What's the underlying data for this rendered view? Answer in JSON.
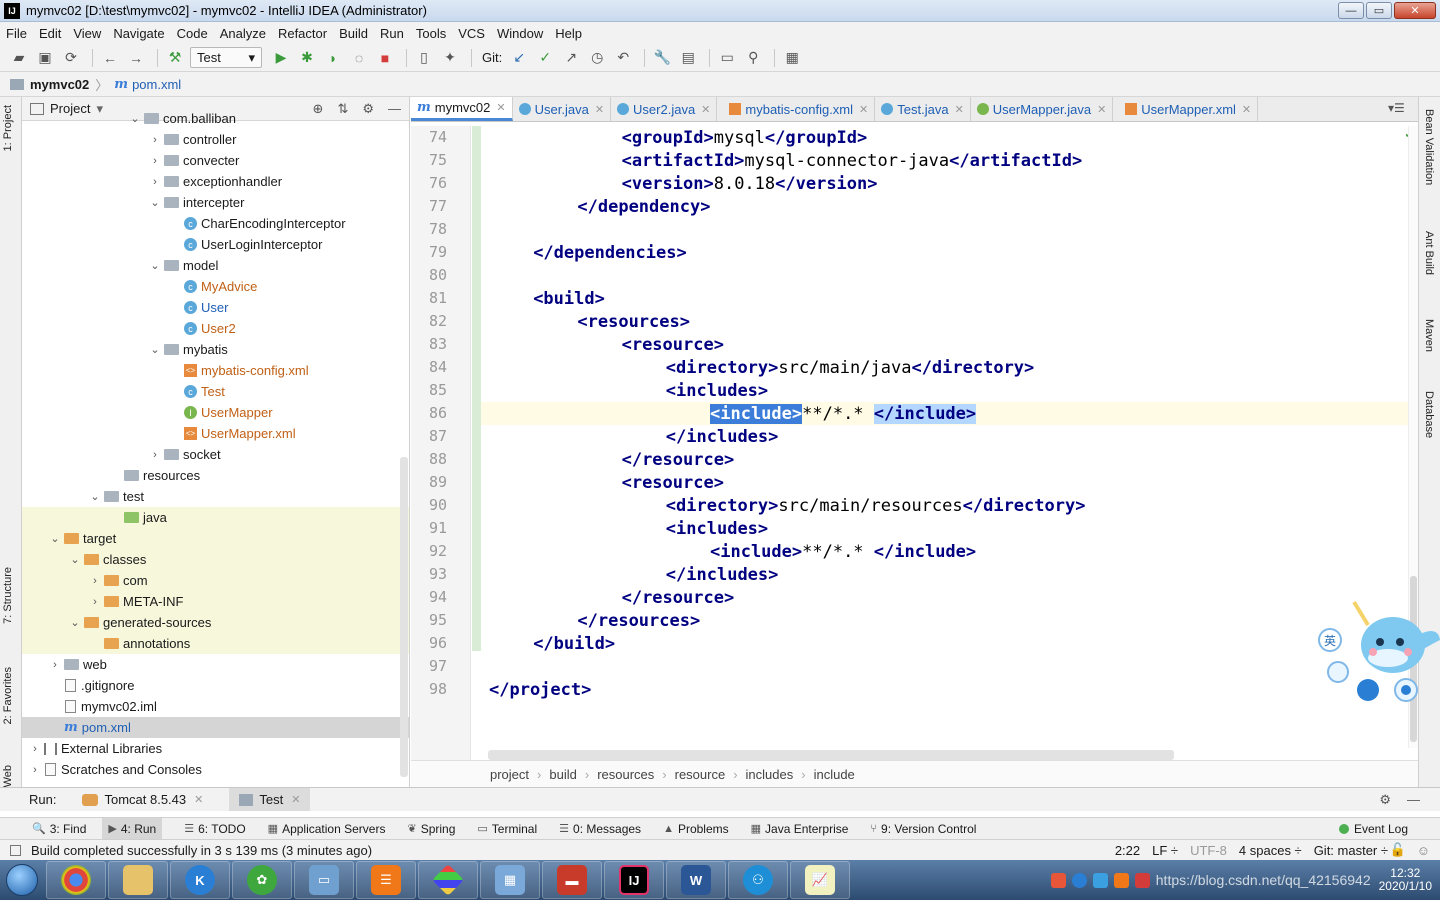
{
  "window": {
    "logo": "IJ",
    "title": "mymvc02 [D:\\test\\mymvc02] - mymvc02 - IntelliJ IDEA (Administrator)",
    "min": "—",
    "max": "▭",
    "close": "✕"
  },
  "menu": [
    "File",
    "Edit",
    "View",
    "Navigate",
    "Code",
    "Analyze",
    "Refactor",
    "Build",
    "Run",
    "Tools",
    "VCS",
    "Window",
    "Help"
  ],
  "toolbar": {
    "run_config": "Test",
    "git_label": "Git:"
  },
  "navbar": {
    "project": "mymvc02",
    "file": "pom.xml"
  },
  "left_tabs": {
    "project": "1: Project",
    "structure": "7: Structure",
    "favorites": "2: Favorites",
    "web": "Web"
  },
  "project_panel": {
    "title": "Project",
    "tree": [
      {
        "label": "com.balliban",
        "kind": "folder",
        "level": 5,
        "arrow": "open",
        "color": "normal"
      },
      {
        "label": "controller",
        "kind": "folder",
        "level": 6,
        "arrow": "closed",
        "color": "normal"
      },
      {
        "label": "convecter",
        "kind": "folder",
        "level": 6,
        "arrow": "closed",
        "color": "normal"
      },
      {
        "label": "exceptionhandler",
        "kind": "folder",
        "level": 6,
        "arrow": "closed",
        "color": "normal"
      },
      {
        "label": "intercepter",
        "kind": "folder",
        "level": 6,
        "arrow": "open",
        "color": "normal"
      },
      {
        "label": "CharEncodingInterceptor",
        "kind": "class",
        "level": 7,
        "arrow": "none",
        "color": "normal"
      },
      {
        "label": "UserLoginInterceptor",
        "kind": "class",
        "level": 7,
        "arrow": "none",
        "color": "normal"
      },
      {
        "label": "model",
        "kind": "folder",
        "level": 6,
        "arrow": "open",
        "color": "normal"
      },
      {
        "label": "MyAdvice",
        "kind": "class",
        "level": 7,
        "arrow": "none",
        "color": "orange"
      },
      {
        "label": "User",
        "kind": "class",
        "level": 7,
        "arrow": "none",
        "color": "blue"
      },
      {
        "label": "User2",
        "kind": "class",
        "level": 7,
        "arrow": "none",
        "color": "orange"
      },
      {
        "label": "mybatis",
        "kind": "folder",
        "level": 6,
        "arrow": "open",
        "color": "normal"
      },
      {
        "label": "mybatis-config.xml",
        "kind": "xml",
        "level": 7,
        "arrow": "none",
        "color": "orange"
      },
      {
        "label": "Test",
        "kind": "class",
        "level": 7,
        "arrow": "none",
        "color": "orange"
      },
      {
        "label": "UserMapper",
        "kind": "iface",
        "level": 7,
        "arrow": "none",
        "color": "orange"
      },
      {
        "label": "UserMapper.xml",
        "kind": "xml",
        "level": 7,
        "arrow": "none",
        "color": "orange"
      },
      {
        "label": "socket",
        "kind": "folder",
        "level": 6,
        "arrow": "closed",
        "color": "normal"
      },
      {
        "label": "resources",
        "kind": "folder",
        "level": 4,
        "arrow": "none",
        "color": "normal"
      },
      {
        "label": "test",
        "kind": "folder",
        "level": 3,
        "arrow": "open",
        "color": "normal"
      },
      {
        "label": "java",
        "kind": "folder-green",
        "level": 4,
        "arrow": "none",
        "color": "normal",
        "hl": true
      },
      {
        "label": "target",
        "kind": "folder-orange",
        "level": 1,
        "arrow": "open",
        "color": "normal",
        "hl": true
      },
      {
        "label": "classes",
        "kind": "folder-orange",
        "level": 2,
        "arrow": "open",
        "color": "normal",
        "hl": true
      },
      {
        "label": "com",
        "kind": "folder-orange",
        "level": 3,
        "arrow": "closed",
        "color": "normal",
        "hl": true
      },
      {
        "label": "META-INF",
        "kind": "folder-orange",
        "level": 3,
        "arrow": "closed",
        "color": "normal",
        "hl": true
      },
      {
        "label": "generated-sources",
        "kind": "folder-orange",
        "level": 2,
        "arrow": "open",
        "color": "normal",
        "hl": true
      },
      {
        "label": "annotations",
        "kind": "folder-orange",
        "level": 3,
        "arrow": "none",
        "color": "normal",
        "hl": true
      },
      {
        "label": "web",
        "kind": "folder",
        "level": 1,
        "arrow": "closed",
        "color": "normal"
      },
      {
        "label": ".gitignore",
        "kind": "file",
        "level": 1,
        "arrow": "none",
        "color": "normal"
      },
      {
        "label": "mymvc02.iml",
        "kind": "file",
        "level": 1,
        "arrow": "none",
        "color": "normal"
      },
      {
        "label": "pom.xml",
        "kind": "m",
        "level": 1,
        "arrow": "none",
        "color": "blue",
        "sel": true
      },
      {
        "label": "External Libraries",
        "kind": "lib",
        "level": 0,
        "arrow": "closed",
        "color": "normal"
      },
      {
        "label": "Scratches and Consoles",
        "kind": "scratch",
        "level": 0,
        "arrow": "closed",
        "color": "normal"
      }
    ]
  },
  "tabs": [
    {
      "label": "mymvc02",
      "icon": "m",
      "active": true
    },
    {
      "label": "User.java",
      "icon": "c"
    },
    {
      "label": "User2.java",
      "icon": "c"
    },
    {
      "label": "mybatis-config.xml",
      "icon": "x"
    },
    {
      "label": "Test.java",
      "icon": "c"
    },
    {
      "label": "UserMapper.java",
      "icon": "i"
    },
    {
      "label": "UserMapper.xml",
      "icon": "x"
    }
  ],
  "editor": {
    "lines": [
      {
        "n": "74",
        "i": 3,
        "parts": [
          [
            "t",
            "<groupId>"
          ],
          [
            "p",
            "mysql"
          ],
          [
            "t",
            "</groupId>"
          ]
        ]
      },
      {
        "n": "75",
        "i": 3,
        "parts": [
          [
            "t",
            "<artifactId>"
          ],
          [
            "p",
            "mysql-connector-java"
          ],
          [
            "t",
            "</artifactId>"
          ]
        ]
      },
      {
        "n": "76",
        "i": 3,
        "parts": [
          [
            "t",
            "<version>"
          ],
          [
            "p",
            "8.0.18"
          ],
          [
            "t",
            "</version>"
          ]
        ]
      },
      {
        "n": "77",
        "i": 2,
        "parts": [
          [
            "t",
            "</dependency>"
          ]
        ],
        "fold": true
      },
      {
        "n": "78",
        "i": 0,
        "parts": []
      },
      {
        "n": "79",
        "i": 1,
        "parts": [
          [
            "t",
            "</dependencies>"
          ]
        ],
        "fold": true
      },
      {
        "n": "80",
        "i": 0,
        "parts": []
      },
      {
        "n": "81",
        "i": 1,
        "parts": [
          [
            "t",
            "<build>"
          ]
        ],
        "fold": true
      },
      {
        "n": "82",
        "i": 2,
        "parts": [
          [
            "t",
            "<resources>"
          ]
        ],
        "fold": true
      },
      {
        "n": "83",
        "i": 3,
        "parts": [
          [
            "t",
            "<resource>"
          ]
        ],
        "fold": true
      },
      {
        "n": "84",
        "i": 4,
        "parts": [
          [
            "t",
            "<directory>"
          ],
          [
            "p",
            "src/main/java"
          ],
          [
            "t",
            "</directory>"
          ]
        ]
      },
      {
        "n": "85",
        "i": 4,
        "parts": [
          [
            "t",
            "<includes>"
          ]
        ],
        "fold": true
      },
      {
        "n": "86",
        "i": 5,
        "parts": [
          [
            "s",
            "<include>"
          ],
          [
            "p",
            "**/*.* "
          ],
          [
            "m",
            "</include>"
          ]
        ],
        "cur": true
      },
      {
        "n": "87",
        "i": 4,
        "parts": [
          [
            "t",
            "</includes>"
          ]
        ],
        "fold": true
      },
      {
        "n": "88",
        "i": 3,
        "parts": [
          [
            "t",
            "</resource>"
          ]
        ],
        "fold": true
      },
      {
        "n": "89",
        "i": 3,
        "parts": [
          [
            "t",
            "<resource>"
          ]
        ],
        "fold": true
      },
      {
        "n": "90",
        "i": 4,
        "parts": [
          [
            "t",
            "<directory>"
          ],
          [
            "p",
            "src/main/resources"
          ],
          [
            "t",
            "</directory>"
          ]
        ]
      },
      {
        "n": "91",
        "i": 4,
        "parts": [
          [
            "t",
            "<includes>"
          ]
        ],
        "fold": true
      },
      {
        "n": "92",
        "i": 5,
        "parts": [
          [
            "t",
            "<include>"
          ],
          [
            "p",
            "**/*.* "
          ],
          [
            "t",
            "</include>"
          ]
        ]
      },
      {
        "n": "93",
        "i": 4,
        "parts": [
          [
            "t",
            "</includes>"
          ]
        ],
        "fold": true
      },
      {
        "n": "94",
        "i": 3,
        "parts": [
          [
            "t",
            "</resource>"
          ]
        ],
        "fold": true
      },
      {
        "n": "95",
        "i": 2,
        "parts": [
          [
            "t",
            "</resources>"
          ]
        ],
        "fold": true
      },
      {
        "n": "96",
        "i": 1,
        "parts": [
          [
            "t",
            "</build>"
          ]
        ],
        "fold": true
      },
      {
        "n": "97",
        "i": 0,
        "parts": []
      },
      {
        "n": "98",
        "i": 0,
        "parts": [
          [
            "t",
            "</project>"
          ]
        ],
        "fold": true
      }
    ]
  },
  "breadcrumbs": [
    "project",
    "build",
    "resources",
    "resource",
    "includes",
    "include"
  ],
  "right_tabs": [
    "Bean Validation",
    "Ant Build",
    "Maven",
    "Database"
  ],
  "runbar": {
    "label": "Run:",
    "tabs": [
      "Tomcat 8.5.43",
      "Test"
    ]
  },
  "toolwindows": [
    {
      "label": "3: Find",
      "icon": "🔍"
    },
    {
      "label": "4: Run",
      "icon": "▶",
      "active": true
    },
    {
      "label": "6: TODO",
      "icon": "☰"
    },
    {
      "label": "Application Servers",
      "icon": "▦"
    },
    {
      "label": "Spring",
      "icon": "❦"
    },
    {
      "label": "Terminal",
      "icon": "▭"
    },
    {
      "label": "0: Messages",
      "icon": "☰"
    },
    {
      "label": "Problems",
      "icon": "▲"
    },
    {
      "label": "Java Enterprise",
      "icon": "▦"
    },
    {
      "label": "9: Version Control",
      "icon": "⑂"
    }
  ],
  "event_log": "Event Log",
  "status": {
    "message": "Build completed successfully in 3 s 139 ms (3 minutes ago)",
    "position": "2:22",
    "line_sep": "LF ÷",
    "encoding": "UTF-8",
    "indent": "4 spaces ÷",
    "branch": "Git: master ÷"
  },
  "tray": {
    "time": "12:32",
    "date": "2020/1/10",
    "watermark": "https://blog.csdn.net/qq_42156942"
  },
  "colors": {
    "tag": "#000080",
    "selection": "#3b7dd8",
    "accent": "#4a88d6"
  }
}
